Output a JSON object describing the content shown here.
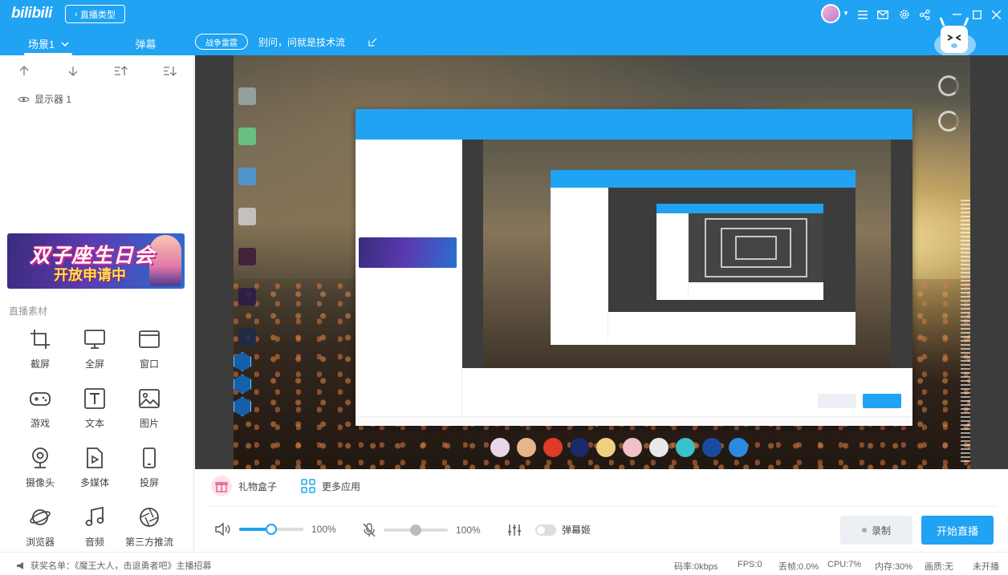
{
  "app": {
    "logo": "bilibili",
    "back_label": "直播类型"
  },
  "header": {
    "scene_tab": "场景1",
    "danmu_tab": "弹幕",
    "category": "战争雷霆",
    "room_title": "别问，问就是技术流"
  },
  "sources": {
    "order_icons": [
      "move-up-icon",
      "move-down-icon",
      "move-top-icon",
      "move-bottom-icon"
    ],
    "items": [
      {
        "label": "显示器 1"
      }
    ]
  },
  "banner": {
    "line1": "双子座生日会",
    "line2": "开放申请中"
  },
  "materials": {
    "title": "直播素材",
    "tools": [
      {
        "label": "截屏",
        "icon": "crop-icon"
      },
      {
        "label": "全屏",
        "icon": "monitor-icon"
      },
      {
        "label": "窗口",
        "icon": "window-icon"
      },
      {
        "label": "游戏",
        "icon": "gamepad-icon"
      },
      {
        "label": "文本",
        "icon": "text-icon"
      },
      {
        "label": "图片",
        "icon": "image-icon"
      },
      {
        "label": "摄像头",
        "icon": "camera-icon"
      },
      {
        "label": "多媒体",
        "icon": "media-icon"
      },
      {
        "label": "投屏",
        "icon": "phone-icon"
      },
      {
        "label": "浏览器",
        "icon": "planet-icon"
      },
      {
        "label": "音频",
        "icon": "music-icon"
      },
      {
        "label": "第三方推流",
        "icon": "aperture-icon"
      }
    ]
  },
  "controls": {
    "gift_box": "礼物盒子",
    "more_apps": "更多应用",
    "speaker_volume": "100%",
    "speaker_level": 0.5,
    "mic_volume": "100%",
    "mic_level": 0.5,
    "danmu_toggle": "弹幕姬",
    "record": "录制",
    "start_live": "开始直播"
  },
  "status": {
    "ticker": "获奖名单：《魔王大人，击退勇者吧》主播招募",
    "bitrate": "码率:0kbps",
    "fps": "FPS:0",
    "drop": "丢帧:0.0%",
    "cpu": "CPU:7%",
    "mem": "内存:30%",
    "quality": "画质:无",
    "live_state": "未开播"
  },
  "colors": {
    "brand": "#1fa3f2"
  }
}
